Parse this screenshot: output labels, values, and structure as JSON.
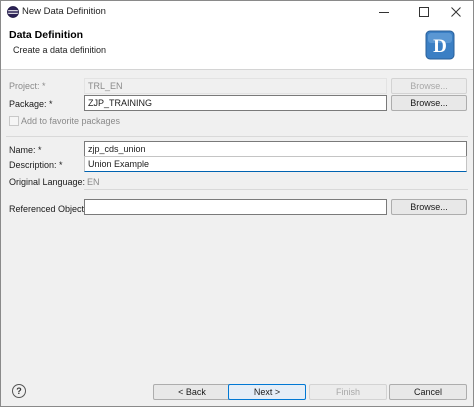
{
  "window": {
    "title": "New Data Definition"
  },
  "banner": {
    "title": "Data Definition",
    "subtitle": "Create a data definition",
    "logo_letter": "D",
    "logo_color": "#3b7fc4"
  },
  "form": {
    "project": {
      "label": "Project: *",
      "value": "TRL_EN",
      "browse": "Browse..."
    },
    "package": {
      "label": "Package: *",
      "value": "ZJP_TRAINING",
      "browse": "Browse..."
    },
    "favorite": {
      "label": "Add to favorite packages",
      "checked": false
    },
    "name": {
      "label": "Name: *",
      "value": "zjp_cds_union"
    },
    "description": {
      "label": "Description: *",
      "value": "Union Example"
    },
    "original_language": {
      "label": "Original Language:",
      "value": "EN"
    },
    "referenced_object": {
      "label": "Referenced Object:",
      "value": "",
      "browse": "Browse..."
    }
  },
  "footer": {
    "help_icon": "help-icon",
    "back": "< Back",
    "next": "Next >",
    "finish": "Finish",
    "cancel": "Cancel"
  }
}
